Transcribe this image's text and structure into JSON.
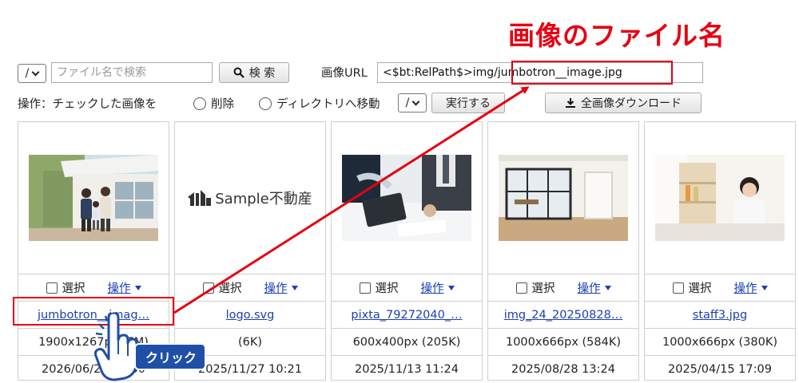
{
  "annotation": {
    "title": "画像のファイル名",
    "click_label": "クリック"
  },
  "search": {
    "dir_select": "/",
    "placeholder": "ファイル名で検索",
    "button": "検 索"
  },
  "image_url": {
    "label": "画像URL",
    "value": "<$bt:RelPath$>img/jumbotron__image.jpg"
  },
  "operations": {
    "label": "操作：チェックした画像を",
    "delete": "削除",
    "move": "ディレクトリへ移動",
    "move_dir": "/",
    "run": "実行する",
    "download_all": "全画像ダウンロード"
  },
  "cards": [
    {
      "check": "選択",
      "ops": "操作",
      "filename": "jumbotron__imag…",
      "size": "1900x1267px (7M)",
      "date": "2026/06/25 10:30",
      "thumb": "house-family-photo"
    },
    {
      "check": "選択",
      "ops": "操作",
      "filename": "logo.svg",
      "size": "(6K)",
      "date": "2025/11/27 10:21",
      "thumb": "sample-logo",
      "logo_text": "Sample不動産"
    },
    {
      "check": "選択",
      "ops": "操作",
      "filename": "pixta_79272040_…",
      "size": "600x400px (205K)",
      "date": "2025/11/13 11:24",
      "thumb": "business-meeting-photo"
    },
    {
      "check": "選択",
      "ops": "操作",
      "filename": "img_24_20250828…",
      "size": "1000x666px (584K)",
      "date": "2025/08/28 13:24",
      "thumb": "office-interior-photo"
    },
    {
      "check": "選択",
      "ops": "操作",
      "filename": "staff3.jpg",
      "size": "1000x666px (380K)",
      "date": "2025/04/15 17:09",
      "thumb": "staff-woman-photo"
    }
  ],
  "colors": {
    "annotation_red": "#e60012",
    "link_blue": "#1a3fb5",
    "badge_blue": "#1f4fa8"
  }
}
